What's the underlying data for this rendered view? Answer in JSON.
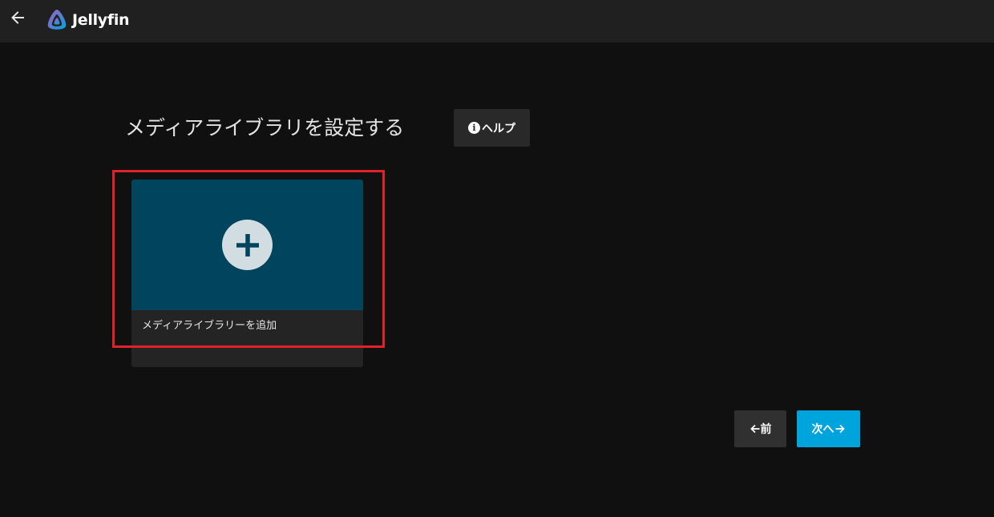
{
  "header": {
    "app_name": "Jellyfin",
    "back_icon": "arrow-left-icon",
    "logo_icon": "jellyfin-logo-icon"
  },
  "page": {
    "title": "メディアライブラリを設定する"
  },
  "help_button": {
    "icon": "info-icon",
    "icon_glyph": "i",
    "label": "ヘルプ"
  },
  "add_library_card": {
    "icon": "plus-icon",
    "label": "メディアライブラリーを追加"
  },
  "nav": {
    "prev_label": "前",
    "next_label": "次へ"
  },
  "colors": {
    "background": "#101010",
    "header": "#202020",
    "card_image": "#00445e",
    "accent": "#00a4dc",
    "highlight": "#e0202a"
  }
}
